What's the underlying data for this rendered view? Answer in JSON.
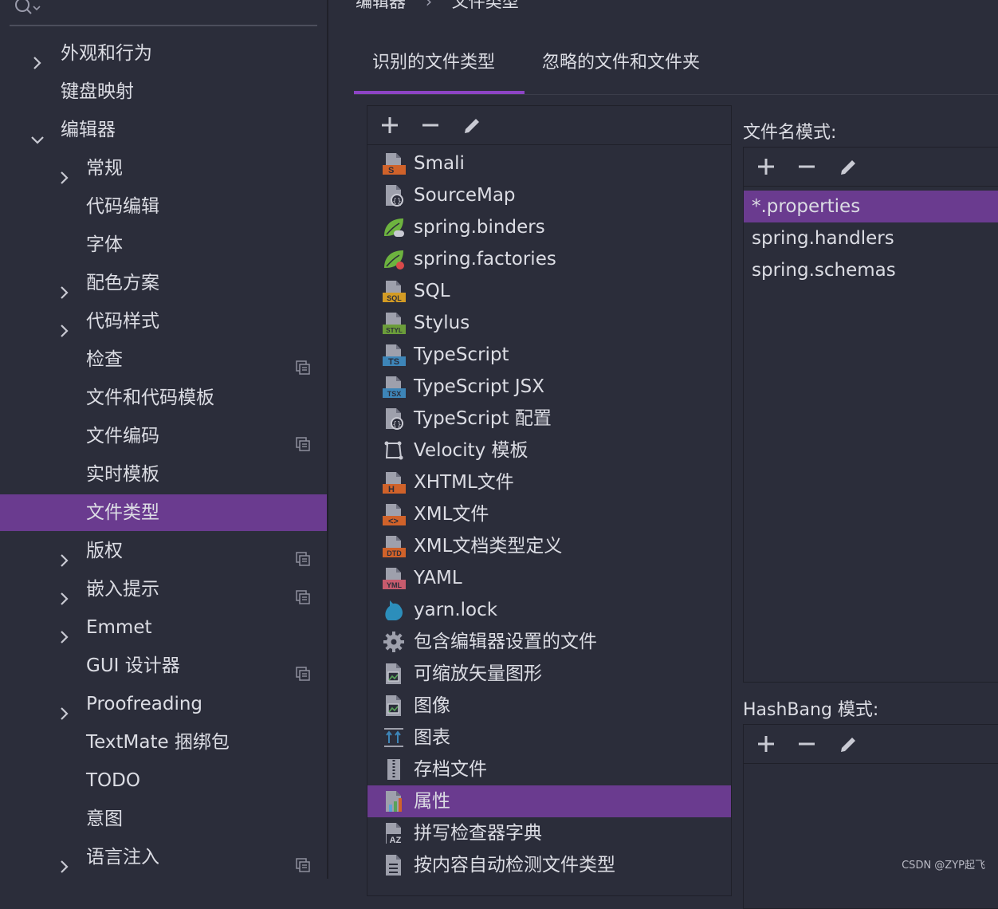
{
  "sidebar": {
    "items": [
      {
        "label": "外观和行为",
        "level": 0,
        "chevron": "right",
        "overlay": false,
        "selected": false
      },
      {
        "label": "键盘映射",
        "level": 0,
        "chevron": "none",
        "overlay": false,
        "selected": false
      },
      {
        "label": "编辑器",
        "level": 0,
        "chevron": "down",
        "overlay": false,
        "selected": false
      },
      {
        "label": "常规",
        "level": 1,
        "chevron": "right",
        "overlay": false,
        "selected": false
      },
      {
        "label": "代码编辑",
        "level": 1,
        "chevron": "none",
        "overlay": false,
        "selected": false
      },
      {
        "label": "字体",
        "level": 1,
        "chevron": "none",
        "overlay": false,
        "selected": false
      },
      {
        "label": "配色方案",
        "level": 1,
        "chevron": "right",
        "overlay": false,
        "selected": false
      },
      {
        "label": "代码样式",
        "level": 1,
        "chevron": "right",
        "overlay": false,
        "selected": false
      },
      {
        "label": "检查",
        "level": 1,
        "chevron": "none",
        "overlay": true,
        "selected": false
      },
      {
        "label": "文件和代码模板",
        "level": 1,
        "chevron": "none",
        "overlay": false,
        "selected": false
      },
      {
        "label": "文件编码",
        "level": 1,
        "chevron": "none",
        "overlay": true,
        "selected": false
      },
      {
        "label": "实时模板",
        "level": 1,
        "chevron": "none",
        "overlay": false,
        "selected": false
      },
      {
        "label": "文件类型",
        "level": 1,
        "chevron": "none",
        "overlay": false,
        "selected": true
      },
      {
        "label": "版权",
        "level": 1,
        "chevron": "right",
        "overlay": true,
        "selected": false
      },
      {
        "label": "嵌入提示",
        "level": 1,
        "chevron": "right",
        "overlay": true,
        "selected": false
      },
      {
        "label": "Emmet",
        "level": 1,
        "chevron": "right",
        "overlay": false,
        "selected": false
      },
      {
        "label": "GUI 设计器",
        "level": 1,
        "chevron": "none",
        "overlay": true,
        "selected": false
      },
      {
        "label": "Proofreading",
        "level": 1,
        "chevron": "right",
        "overlay": false,
        "selected": false
      },
      {
        "label": "TextMate 捆绑包",
        "level": 1,
        "chevron": "none",
        "overlay": false,
        "selected": false
      },
      {
        "label": "TODO",
        "level": 1,
        "chevron": "none",
        "overlay": false,
        "selected": false
      },
      {
        "label": "意图",
        "level": 1,
        "chevron": "none",
        "overlay": false,
        "selected": false
      },
      {
        "label": "语言注入",
        "level": 1,
        "chevron": "right",
        "overlay": true,
        "selected": false
      }
    ]
  },
  "breadcrumb": {
    "part1": "编辑器",
    "sep": "›",
    "part2": "文件类型"
  },
  "tabs": [
    {
      "label": "识别的文件类型",
      "active": true
    },
    {
      "label": "忽略的文件和文件夹",
      "active": false
    }
  ],
  "file_types": [
    {
      "label": "Smali",
      "icon": "file-badge-icon",
      "badge": "S",
      "color": "#d0622a"
    },
    {
      "label": "SourceMap",
      "icon": "file-config-icon"
    },
    {
      "label": "spring.binders",
      "icon": "spring-leaf-icon",
      "color": "#6db33f"
    },
    {
      "label": "spring.factories",
      "icon": "spring-leaf-icon",
      "color": "#6db33f"
    },
    {
      "label": "SQL",
      "icon": "file-badge-icon",
      "badge": "SQL",
      "color": "#d39b24"
    },
    {
      "label": "Stylus",
      "icon": "file-badge-icon",
      "badge": "STYL",
      "color": "#6b9d3a"
    },
    {
      "label": "TypeScript",
      "icon": "file-badge-icon",
      "badge": "TS",
      "color": "#3d85b8"
    },
    {
      "label": "TypeScript JSX",
      "icon": "file-badge-icon",
      "badge": "TSX",
      "color": "#3d85b8"
    },
    {
      "label": "TypeScript 配置",
      "icon": "file-config-icon"
    },
    {
      "label": "Velocity 模板",
      "icon": "velocity-icon"
    },
    {
      "label": "XHTML文件",
      "icon": "file-badge-icon",
      "badge": "H",
      "color": "#d0622a"
    },
    {
      "label": "XML文件",
      "icon": "file-badge-icon",
      "badge": "<>",
      "color": "#d0622a"
    },
    {
      "label": "XML文档类型定义",
      "icon": "file-badge-icon",
      "badge": "DTD",
      "color": "#d0622a"
    },
    {
      "label": "YAML",
      "icon": "file-badge-icon",
      "badge": "YML",
      "color": "#c75b6d"
    },
    {
      "label": "yarn.lock",
      "icon": "yarn-cat-icon",
      "color": "#2c8ebb"
    },
    {
      "label": "包含编辑器设置的文件",
      "icon": "gear-icon"
    },
    {
      "label": "可缩放矢量图形",
      "icon": "image-file-icon"
    },
    {
      "label": "图像",
      "icon": "image-file-icon"
    },
    {
      "label": "图表",
      "icon": "diagram-icon"
    },
    {
      "label": "存档文件",
      "icon": "archive-icon"
    },
    {
      "label": "属性",
      "icon": "properties-file-icon"
    },
    {
      "label": "拼写检查器字典",
      "icon": "dictionary-file-icon"
    },
    {
      "label": "按内容自动检测文件类型",
      "icon": "text-file-icon"
    }
  ],
  "selected_file_type_index": 20,
  "patterns": {
    "label": "文件名模式:",
    "items": [
      "*.properties",
      "spring.handlers",
      "spring.schemas"
    ],
    "selected_index": 0
  },
  "hashbang": {
    "label": "HashBang 模式:"
  },
  "watermark": "CSDN @ZYP起飞",
  "colors": {
    "selection": "#6a3b8f",
    "accent": "#8d44c5",
    "background": "#2b2d3a",
    "text": "#dcdde4"
  }
}
